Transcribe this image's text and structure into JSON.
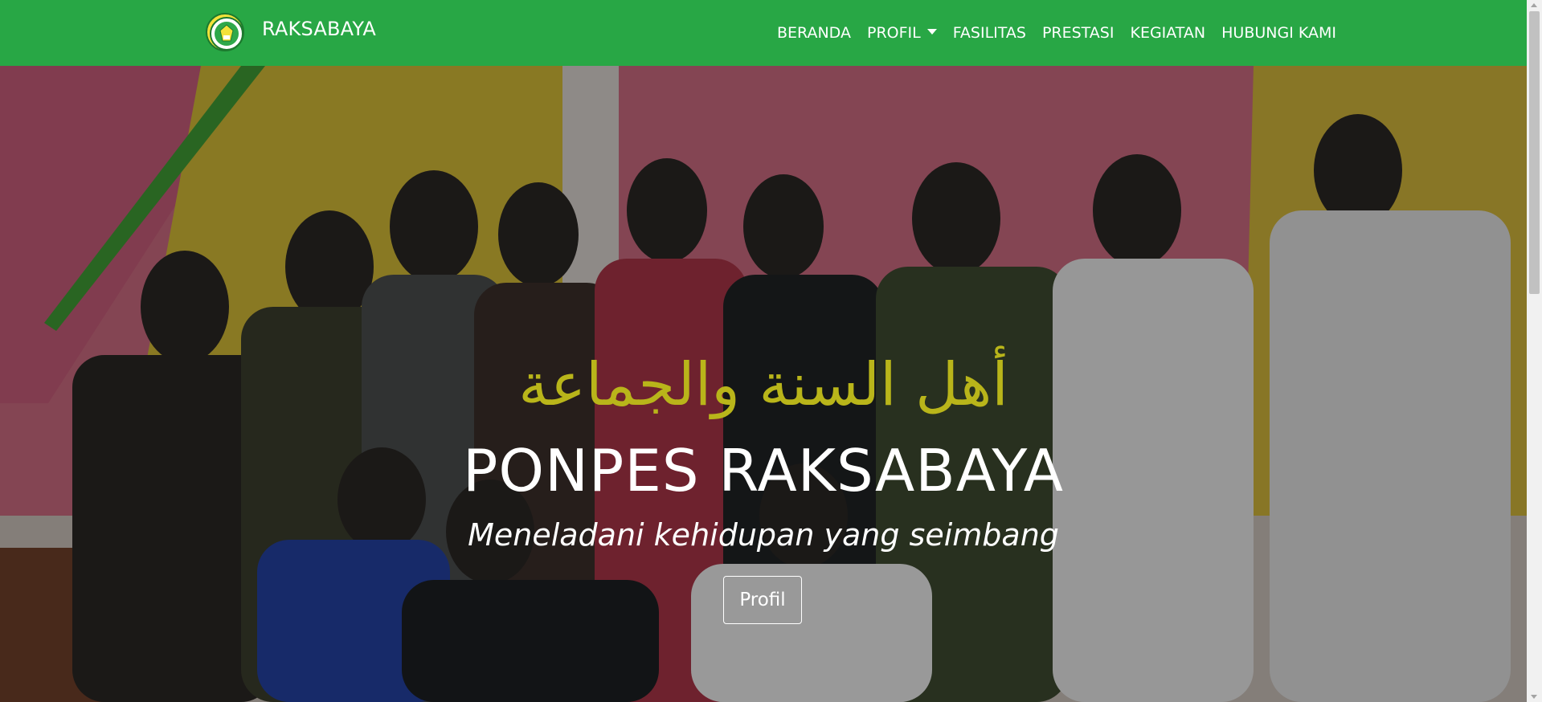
{
  "navbar": {
    "brand_name": "RAKSABAYA",
    "background_color": "#28a745",
    "links": [
      {
        "label": "BERANDA"
      },
      {
        "label": "PROFIL",
        "has_dropdown": true
      },
      {
        "label": "FASILITAS"
      },
      {
        "label": "PRESTASI"
      },
      {
        "label": "KEGIATAN"
      },
      {
        "label": "HUBUNGI KAMI"
      }
    ]
  },
  "hero": {
    "arabic_title": "أهل السنة والجماعة",
    "title": "PONPES RAKSABAYA",
    "subtitle": "Meneladani kehidupan yang seimbang",
    "button_label": "Profil",
    "arabic_title_color": "#b9b51a"
  }
}
